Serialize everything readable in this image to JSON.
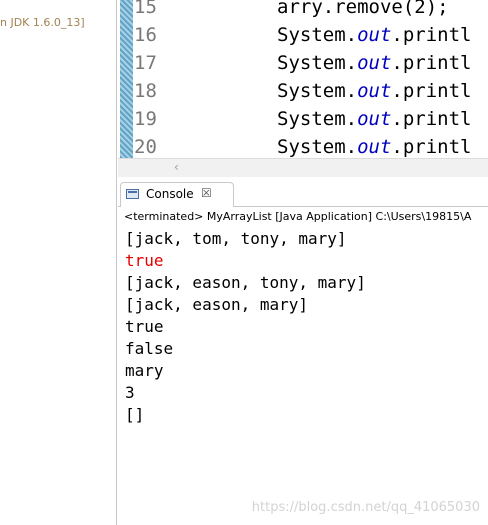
{
  "left_pane": {
    "jdk_label": "n JDK 1.6.0_13]"
  },
  "editor": {
    "lines": [
      {
        "number": "15",
        "prefix": "arry.remove(2);",
        "kw": "",
        "suffix": ""
      },
      {
        "number": "16",
        "prefix": "System.",
        "kw": "out",
        "suffix": ".printl"
      },
      {
        "number": "17",
        "prefix": "System.",
        "kw": "out",
        "suffix": ".printl"
      },
      {
        "number": "18",
        "prefix": "System.",
        "kw": "out",
        "suffix": ".printl"
      },
      {
        "number": "19",
        "prefix": "System.",
        "kw": "out",
        "suffix": ".printl"
      },
      {
        "number": "20",
        "prefix": "System.",
        "kw": "out",
        "suffix": ".printl"
      }
    ]
  },
  "scrollbar": {
    "left_arrow": "‹"
  },
  "console": {
    "tab_label": "Console",
    "tab_close": "☒",
    "status": "<terminated> MyArrayList [Java Application] C:\\Users\\19815\\A",
    "output": [
      {
        "text": "[jack, tom, tony, mary]",
        "error": false
      },
      {
        "text": "true",
        "error": true
      },
      {
        "text": "[jack, eason, tony, mary]",
        "error": false
      },
      {
        "text": "[jack, eason, mary]",
        "error": false
      },
      {
        "text": "true",
        "error": false
      },
      {
        "text": "false",
        "error": false
      },
      {
        "text": "mary",
        "error": false
      },
      {
        "text": "3",
        "error": false
      },
      {
        "text": "[]",
        "error": false
      }
    ]
  },
  "watermark": "https://blog.csdn.net/qq_41065030",
  "colors": {
    "keyword": "#0000c0",
    "error": "#e60000",
    "line_number": "#787878"
  }
}
